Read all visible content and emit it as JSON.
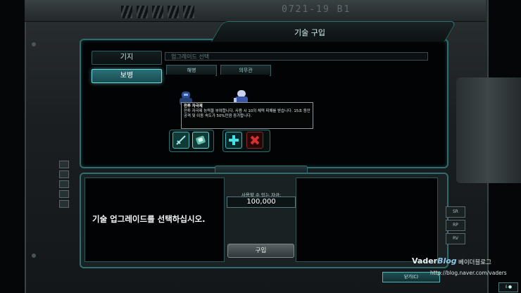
{
  "frame": {
    "serial": "0721-19 B1"
  },
  "window": {
    "title": "기술 구입"
  },
  "sidebar": {
    "items": [
      {
        "label": "기지",
        "active": false
      },
      {
        "label": "보병",
        "active": true
      }
    ]
  },
  "search": {
    "placeholder": "업그레이드 선택"
  },
  "units": [
    {
      "label": "해병"
    },
    {
      "label": "의무관"
    }
  ],
  "tooltip": {
    "title": "전투 자극제",
    "body": "전투 자극제 능력을 부여합니다. 사용 시 10의 체력 피해를 받습니다. 15초 동안 공격 및 이동 속도가 50%만큼 증가합니다."
  },
  "skills": [
    {
      "icon": "sword-icon"
    },
    {
      "icon": "shield-icon"
    },
    {
      "icon": "plus-icon"
    },
    {
      "icon": "red-cross-icon"
    }
  ],
  "bottom": {
    "message": "기술 업그레이드를 선택하십시오.",
    "funds_label": "사용할 수 있는 자금:",
    "funds_value": "100,000",
    "buy_label": "구입"
  },
  "right_buttons": [
    "SR",
    "RP",
    "RV"
  ],
  "close_label": "닫기(C)",
  "corner_label": "⇩●",
  "watermark": {
    "brand": "Vader",
    "brand_blog": "Blog",
    "korean": "베이더블로그",
    "url": "http://blog.naver.com/vaders"
  },
  "colors": {
    "accent": "#2e6e70",
    "active_button": "#2a6f75",
    "skill_border": "#3fb8bf"
  }
}
